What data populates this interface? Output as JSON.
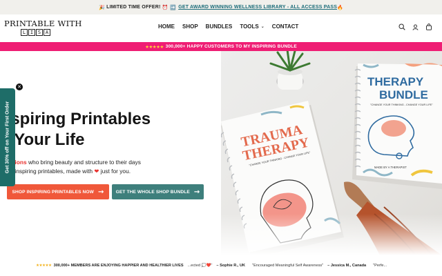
{
  "announcement": {
    "emoji_left": "🎉",
    "prefix": "LIMITED TIME OFFER!",
    "emoji_mid": "⏰ ➡️",
    "link_text": "GET AWARD WINNING WELLNESS LIBRARY - ALL ACCESS PASS",
    "emoji_right": "🔥"
  },
  "logo": {
    "top": "PRINTABLE WITH",
    "letters": [
      "L",
      "I",
      "S",
      "A"
    ]
  },
  "nav": {
    "items": [
      "HOME",
      "SHOP",
      "BUNDLES",
      "TOOLS",
      "CONTACT"
    ]
  },
  "icons": {
    "search": "search-icon",
    "account": "account-icon",
    "cart": "cart-icon"
  },
  "promo_bar": {
    "stars": "★★★★★",
    "text": "300,000+ HAPPY CUSTOMERS TO MY INSPIRING BUNDLE"
  },
  "hero": {
    "headline_1": "Inspiring Printables",
    "headline_2": "or Your Life",
    "lead_1": "n",
    "lead_highlight": "millions",
    "lead_2": "who bring beauty and structure to their days",
    "lead_3": "n our inspiring printables, made with",
    "lead_heart": "❤",
    "lead_4": "just for you.",
    "btn_primary": "SHOP INSPIRING PRINTABLES NOW",
    "btn_secondary": "GET THE WHOLE SHOP BUNDLE",
    "arrow": "→"
  },
  "side_tab": {
    "text": "Get 30% off on Your First Order",
    "close": "✕"
  },
  "products": {
    "book1_title_1": "TRAUMA",
    "book1_title_2": "THERAPY",
    "book1_sub": "\"CHANGE YOUR THINKING - CHANGE YOUR LIFE\"",
    "book2_title_1": "THERAPY",
    "book2_title_2": "BUNDLE",
    "book2_sub": "\"CHANGE YOUR THINKING - CHANGE YOUR LIFE\"",
    "book2_made": "MADE BY A THERAPIST"
  },
  "ticker": {
    "stars": "★★★★★",
    "members": "300,000+ MEMBERS ARE ENJOYING HAPPIER AND HEALTHIER LIVES",
    "quote1": "...ected 💭❤️\"",
    "who1": "– Sophie R., UK",
    "quote2": "\"Encouraged Meaningful Self Awareness\"",
    "who2": "– Jessica M., Canada",
    "quote3": "\"Perfe..."
  },
  "colors": {
    "pink": "#ef1e74",
    "orange": "#f0583a",
    "teal": "#3e7f7c",
    "side_tab": "#1e6d68",
    "announce_bg": "#f1f0ec",
    "link": "#1a6b78"
  }
}
